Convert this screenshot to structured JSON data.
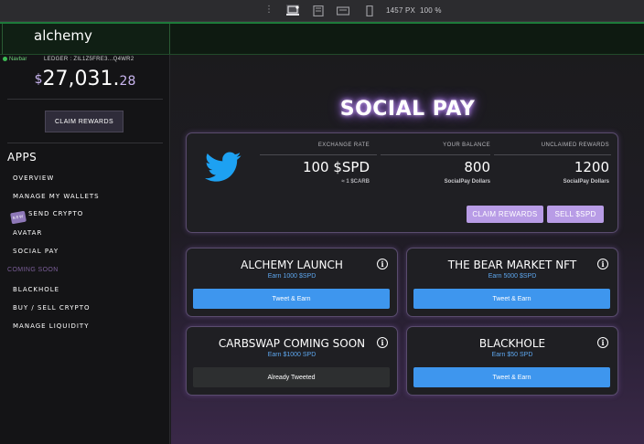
{
  "devtools": {
    "dots": "⋮",
    "width_readout": "1457 PX",
    "zoom_readout": "100 %"
  },
  "app": {
    "brand": "alchemy"
  },
  "sidebar": {
    "navbar_tag": "Navbar",
    "ledger": "LEDGER : ZIL1Z5FRE3...Q4WR2",
    "balance_currency": "$",
    "balance_whole": "27,031.",
    "balance_cents": "28",
    "claim_rewards": "CLAIM REWARDS",
    "apps_title": "APPS",
    "items": [
      {
        "label": "OVERVIEW"
      },
      {
        "label": "MANAGE MY WALLETS"
      },
      {
        "label": "SEND CRYPTO",
        "badge": "NEW"
      },
      {
        "label": "AVATAR"
      },
      {
        "label": "SOCIAL PAY"
      }
    ],
    "coming_soon": "COMING SOON",
    "coming_items": [
      {
        "label": "BLACKHOLE"
      },
      {
        "label": "BUY / SELL CRYPTO"
      },
      {
        "label": "MANAGE LIQUIDITY"
      }
    ]
  },
  "main": {
    "title": "SOCIAL PAY",
    "stats": {
      "exchange_label": "EXCHANGE RATE",
      "exchange_value": "100 $SPD",
      "exchange_sub": "≈ 1 $CARB",
      "balance_label": "YOUR BALANCE",
      "balance_value": "800",
      "balance_sub": "SocialPay Dollars",
      "unclaimed_label": "UNCLAIMED REWARDS",
      "unclaimed_value": "1200",
      "unclaimed_sub": "SocialPay Dollars"
    },
    "claim_button": "CLAIM REWARDS",
    "sell_button": "SELL $SPD",
    "tasks": [
      {
        "name": "ALCHEMY LAUNCH",
        "earn": "Earn 1000 $SPD",
        "button": "Tweet & Earn"
      },
      {
        "name": "THE BEAR MARKET NFT",
        "earn": "Earn 5000 $SPD",
        "button": "Tweet & Earn"
      },
      {
        "name": "CARBSWAP COMING SOON",
        "earn": "Earn $1000 SPD",
        "button": "Already Tweeted"
      },
      {
        "name": "BLACKHOLE",
        "earn": "Earn $50 SPD",
        "button": "Tweet & Earn"
      }
    ],
    "info_glyph": "i"
  },
  "colors": {
    "accent_purple": "#b89ce6",
    "tweet_blue": "#3e96ee",
    "twitter_blue": "#1da1f2",
    "brand_green": "#1d7a3a"
  }
}
